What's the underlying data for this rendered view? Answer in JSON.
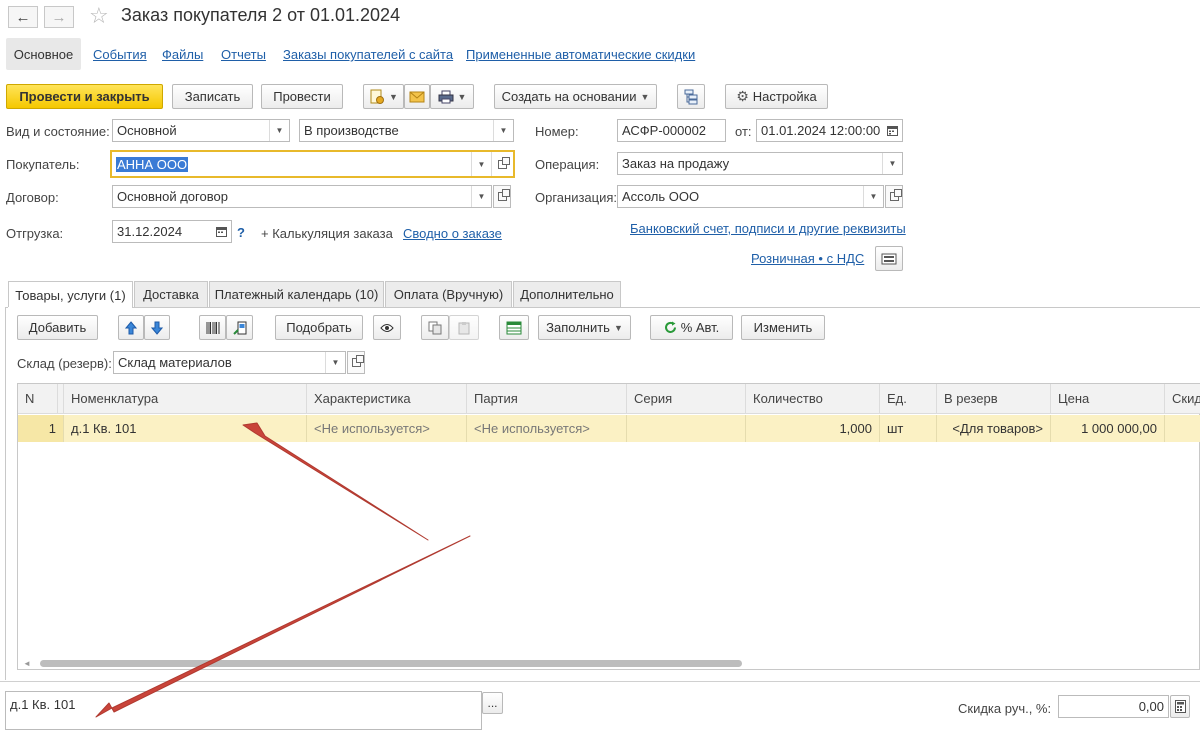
{
  "window": {
    "title": "Заказ покупателя 2 от 01.01.2024",
    "back_icon": "←",
    "forward_icon": "→",
    "star_icon": "☆"
  },
  "sections": {
    "main": "Основное",
    "events": "События",
    "files": "Файлы",
    "reports": "Отчеты",
    "web_orders": "Заказы покупателей с сайта",
    "auto_discounts": "Примененные автоматические скидки"
  },
  "toolbar": {
    "post_close": "Провести и закрыть",
    "save": "Записать",
    "post": "Провести",
    "create_based": "Создать на основании",
    "settings": "Настройка"
  },
  "form": {
    "kind_label": "Вид и состояние:",
    "kind_value": "Основной",
    "state_value": "В производстве",
    "number_label": "Номер:",
    "number_value": "АСФР-000002",
    "date_label": "от:",
    "date_value": "01.01.2024 12:00:00",
    "buyer_label": "Покупатель:",
    "buyer_value": "АННА ООО",
    "operation_label": "Операция:",
    "operation_value": "Заказ на продажу",
    "contract_label": "Договор:",
    "contract_value": "Основной договор",
    "org_label": "Организация:",
    "org_value": "Ассоль ООО",
    "shipment_label": "Отгрузка:",
    "shipment_value": "31.12.2024",
    "help": "?",
    "calc": "+ Калькуляция заказа",
    "summary_link": "Сводно о заказе",
    "bank_link": "Банковский счет, подписи и другие реквизиты",
    "vat_link": "Розничная • с НДС"
  },
  "tabs": [
    "Товары, услуги (1)",
    "Доставка",
    "Платежный календарь (10)",
    "Оплата (Вручную)",
    "Дополнительно"
  ],
  "tab_toolbar": {
    "add": "Добавить",
    "pick": "Подобрать",
    "fill": "Заполнить",
    "auto_pct": "% Авт.",
    "change": "Изменить"
  },
  "warehouse": {
    "label": "Склад (резерв):",
    "value": "Склад материалов"
  },
  "table": {
    "columns": [
      "N",
      "Номенклатура",
      "Характеристика",
      "Партия",
      "Серия",
      "Количество",
      "Ед.",
      "В резерв",
      "Цена",
      "Скид"
    ],
    "rows": [
      {
        "n": "1",
        "item": "д.1 Кв. 101",
        "characteristic": "<Не используется>",
        "batch": "<Не используется>",
        "series": "",
        "quantity": "1,000",
        "unit": "шт",
        "reserve": "<Для товаров>",
        "price": "1 000 000,00"
      }
    ]
  },
  "bottom": {
    "memo": "д.1 Кв. 101",
    "memo_btn": "...",
    "discount_label": "Скидка руч., %:",
    "discount_value": "0,00"
  },
  "colors": {
    "accent_yellow": "#f5c800",
    "selected_row": "#fbf1c4",
    "link": "#1f5fa8",
    "arrow": "#c9443a",
    "focus": "#e8b92b"
  }
}
